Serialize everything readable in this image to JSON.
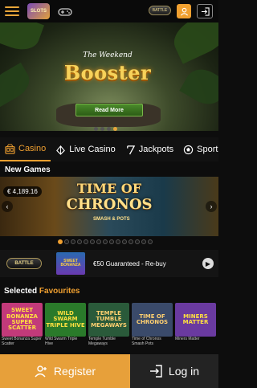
{
  "header": {
    "logo_text": "SLOTS",
    "badge_text": "BATTLE"
  },
  "hero": {
    "tagline": "The Weekend",
    "title": "Booster",
    "button_label": "Read More",
    "dots": 4,
    "active_dot": 3
  },
  "tabs": [
    {
      "label": "Casino",
      "icon": "casino-icon",
      "active": true
    },
    {
      "label": "Live Casino",
      "icon": "live-casino-icon",
      "active": false
    },
    {
      "label": "Jackpots",
      "icon": "jackpots-icon",
      "active": false
    },
    {
      "label": "Sports",
      "icon": "sports-icon",
      "active": false
    }
  ],
  "new_games": {
    "title": "New Games",
    "jackpot": "€ 4,189.16",
    "banner_title_line1": "TIME OF",
    "banner_title_line2": "CHRONOS",
    "banner_sub": "SMASH & POTS"
  },
  "promo": {
    "logo_text": "BATTLE",
    "thumb_text": "SWEET BONANZA",
    "text": "€50 Guaranteed - Re-buy"
  },
  "favourites": {
    "title_prefix": "Selected",
    "title_highlight": "Favourites",
    "games": [
      {
        "thumb": "SWEET BONANZA SUPER SCATTER",
        "name": "Sweet Bonanza Super Scatter",
        "bg": "#c23a7a",
        "fg": "#ffe040"
      },
      {
        "thumb": "WILD SWARM TRIPLE HIVE",
        "name": "Wild Swarm Triple Hive",
        "bg": "#2a7a2a",
        "fg": "#ffe040"
      },
      {
        "thumb": "TEMPLE TUMBLE MEGAWAYS",
        "name": "Temple Tumble Megaways",
        "bg": "#2a5a3a",
        "fg": "#ffd070"
      },
      {
        "thumb": "TIME OF CHRONOS",
        "name": "Time of Chronos Smash Pots",
        "bg": "#3a4a6a",
        "fg": "#ffd070"
      },
      {
        "thumb": "MINERS MATTER",
        "name": "Miners Matter",
        "bg": "#6a3aa0",
        "fg": "#ffe040"
      }
    ]
  },
  "bottom": {
    "register_label": "Register",
    "login_label": "Log in"
  },
  "colors": {
    "accent": "#f0a030",
    "register_bg": "#e7a03a",
    "login_bg": "#232323"
  }
}
